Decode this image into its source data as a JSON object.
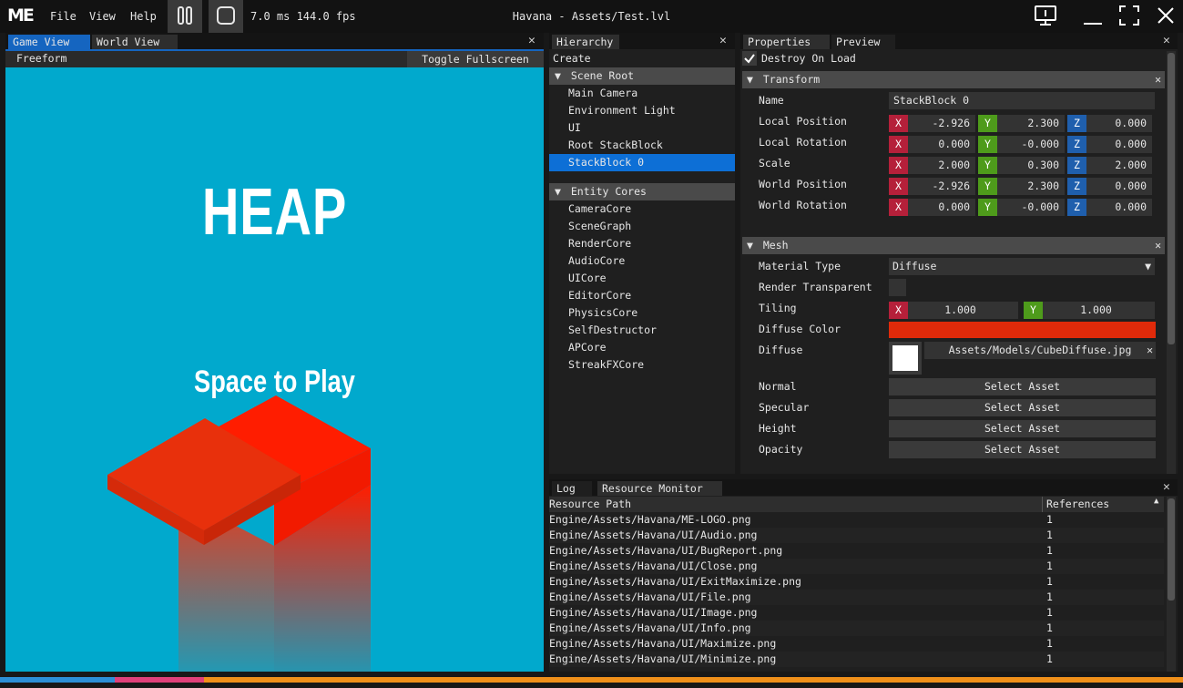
{
  "app": {
    "logo": "ME",
    "menu": [
      "File",
      "View",
      "Help"
    ],
    "stats": "7.0 ms 144.0 fps",
    "title": "Havana - Assets/Test.lvl"
  },
  "game_panel": {
    "tabs": [
      "Game View",
      "World View"
    ],
    "mode": "Freeform",
    "toggle_label": "Toggle Fullscreen",
    "game_title": "HEAP",
    "game_prompt": "Space to Play",
    "bg_color": "#01a9cd"
  },
  "hierarchy": {
    "tab": "Hierarchy",
    "create_label": "Create",
    "scene_root_label": "Scene Root",
    "scene_items": [
      "Main Camera",
      "Environment Light",
      "UI",
      "Root StackBlock",
      "StackBlock 0"
    ],
    "selected_item": "StackBlock 0",
    "entity_cores_label": "Entity Cores",
    "core_items": [
      "CameraCore",
      "SceneGraph",
      "RenderCore",
      "AudioCore",
      "UICore",
      "EditorCore",
      "PhysicsCore",
      "SelfDestructor",
      "APCore",
      "StreakFXCore"
    ]
  },
  "properties": {
    "tabs": [
      "Properties",
      "Preview"
    ],
    "destroy_on_load": "Destroy On Load",
    "transform": {
      "header": "Transform",
      "name_label": "Name",
      "name_value": "StackBlock 0",
      "rows": [
        {
          "label": "Local Position",
          "x": "-2.926",
          "y": "2.300",
          "z": "0.000"
        },
        {
          "label": "Local Rotation",
          "x": "0.000",
          "y": "-0.000",
          "z": "0.000"
        },
        {
          "label": "Scale",
          "x": "2.000",
          "y": "0.300",
          "z": "2.000"
        },
        {
          "label": "World Position",
          "x": "-2.926",
          "y": "2.300",
          "z": "0.000"
        },
        {
          "label": "World Rotation",
          "x": "0.000",
          "y": "-0.000",
          "z": "0.000"
        }
      ]
    },
    "mesh": {
      "header": "Mesh",
      "material_type_label": "Material Type",
      "material_type_value": "Diffuse",
      "render_transparent_label": "Render Transparent",
      "tiling_label": "Tiling",
      "tiling_x": "1.000",
      "tiling_y": "1.000",
      "diffuse_color_label": "Diffuse Color",
      "diffuse_color": "#e02a0a",
      "diffuse_label": "Diffuse",
      "diffuse_path": "Assets/Models/CubeDiffuse.jpg",
      "asset_rows": [
        {
          "label": "Normal",
          "button": "Select Asset"
        },
        {
          "label": "Specular",
          "button": "Select Asset"
        },
        {
          "label": "Height",
          "button": "Select Asset"
        },
        {
          "label": "Opacity",
          "button": "Select Asset"
        }
      ]
    },
    "axis_labels": {
      "x": "X",
      "y": "Y",
      "z": "Z"
    }
  },
  "bottom_panel": {
    "tabs": [
      "Log",
      "Resource Monitor"
    ],
    "columns": [
      "Resource Path",
      "References"
    ],
    "rows": [
      {
        "path": "Engine/Assets/Havana/ME-LOGO.png",
        "refs": "1"
      },
      {
        "path": "Engine/Assets/Havana/UI/Audio.png",
        "refs": "1"
      },
      {
        "path": "Engine/Assets/Havana/UI/BugReport.png",
        "refs": "1"
      },
      {
        "path": "Engine/Assets/Havana/UI/Close.png",
        "refs": "1"
      },
      {
        "path": "Engine/Assets/Havana/UI/ExitMaximize.png",
        "refs": "1"
      },
      {
        "path": "Engine/Assets/Havana/UI/File.png",
        "refs": "1"
      },
      {
        "path": "Engine/Assets/Havana/UI/Image.png",
        "refs": "1"
      },
      {
        "path": "Engine/Assets/Havana/UI/Info.png",
        "refs": "1"
      },
      {
        "path": "Engine/Assets/Havana/UI/Maximize.png",
        "refs": "1"
      },
      {
        "path": "Engine/Assets/Havana/UI/Minimize.png",
        "refs": "1"
      }
    ]
  },
  "colors": {
    "selection": "#0d6fd6",
    "status_segments": [
      "#2c8fd6",
      "#e0407a",
      "#f0901a"
    ]
  }
}
